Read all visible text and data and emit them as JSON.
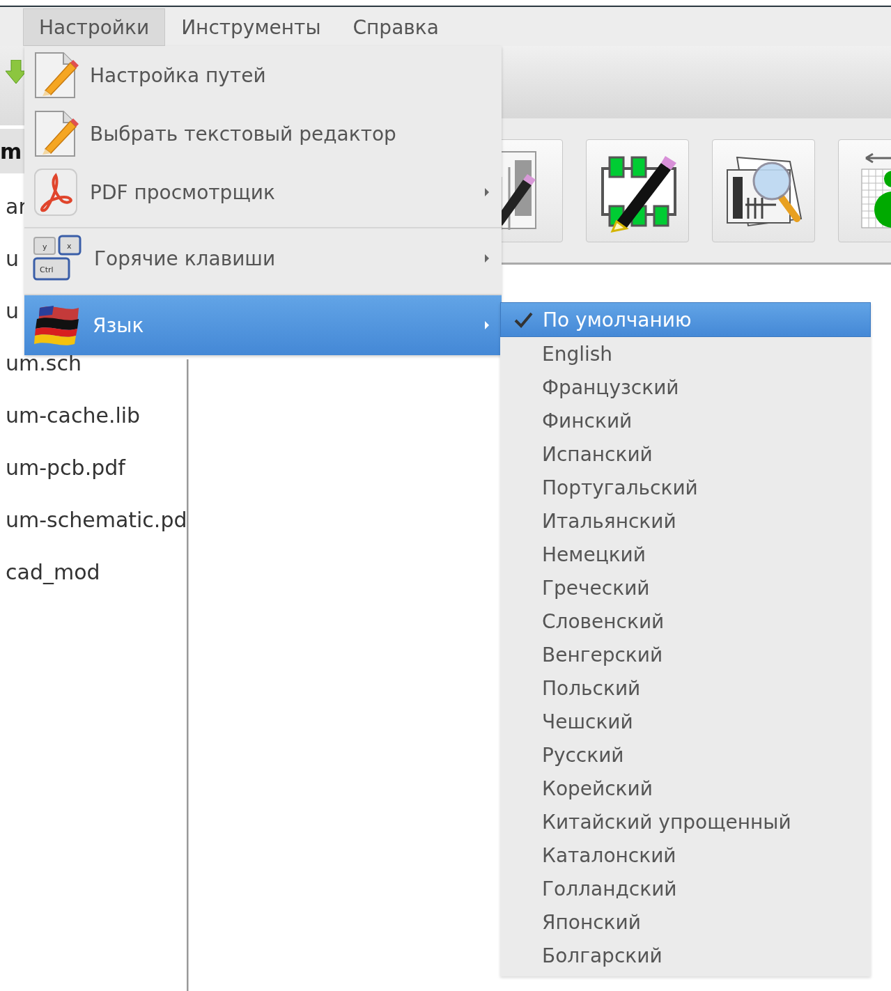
{
  "menubar": [
    {
      "label": "Настройки",
      "selected": true
    },
    {
      "label": "Инструменты",
      "selected": false
    },
    {
      "label": "Справка",
      "selected": false
    }
  ],
  "file_panel": {
    "header": "m",
    "files": [
      "ar",
      "u",
      "u",
      "um.sch",
      "um-cache.lib",
      "um-pcb.pdf",
      "um-schematic.pd",
      "cad_mod"
    ]
  },
  "settings_menu": [
    {
      "label": "Настройка путей",
      "kind": "pencil",
      "submenu": false,
      "separator": false,
      "selected": false
    },
    {
      "label": "Выбрать текстовый редактор",
      "kind": "pencil",
      "submenu": false,
      "separator": false,
      "selected": false
    },
    {
      "label": "PDF просмотрщик",
      "kind": "pdf",
      "submenu": true,
      "separator": false,
      "selected": false
    },
    {
      "label": "Горячие клавиши",
      "kind": "keys",
      "key_labels": [
        "y",
        "x",
        "Ctrl"
      ],
      "submenu": true,
      "separator": true,
      "selected": false
    },
    {
      "label": "Язык",
      "kind": "flag",
      "submenu": true,
      "separator": true,
      "selected": true
    }
  ],
  "language_menu": [
    {
      "label": "По умолчанию",
      "checked": true,
      "selected": true
    },
    {
      "label": "English",
      "checked": false,
      "selected": false
    },
    {
      "label": "Французский",
      "checked": false,
      "selected": false
    },
    {
      "label": "Финский",
      "checked": false,
      "selected": false
    },
    {
      "label": "Испанский",
      "checked": false,
      "selected": false
    },
    {
      "label": "Португальский",
      "checked": false,
      "selected": false
    },
    {
      "label": "Итальянский",
      "checked": false,
      "selected": false
    },
    {
      "label": "Немецкий",
      "checked": false,
      "selected": false
    },
    {
      "label": "Греческий",
      "checked": false,
      "selected": false
    },
    {
      "label": "Словенский",
      "checked": false,
      "selected": false
    },
    {
      "label": "Венгерский",
      "checked": false,
      "selected": false
    },
    {
      "label": "Польский",
      "checked": false,
      "selected": false
    },
    {
      "label": "Чешский",
      "checked": false,
      "selected": false
    },
    {
      "label": "Русский",
      "checked": false,
      "selected": false
    },
    {
      "label": "Корейский",
      "checked": false,
      "selected": false
    },
    {
      "label": "Китайский упрощенный",
      "checked": false,
      "selected": false
    },
    {
      "label": "Каталонский",
      "checked": false,
      "selected": false
    },
    {
      "label": "Голландский",
      "checked": false,
      "selected": false
    },
    {
      "label": "Японский",
      "checked": false,
      "selected": false
    },
    {
      "label": "Болгарский",
      "checked": false,
      "selected": false
    }
  ]
}
